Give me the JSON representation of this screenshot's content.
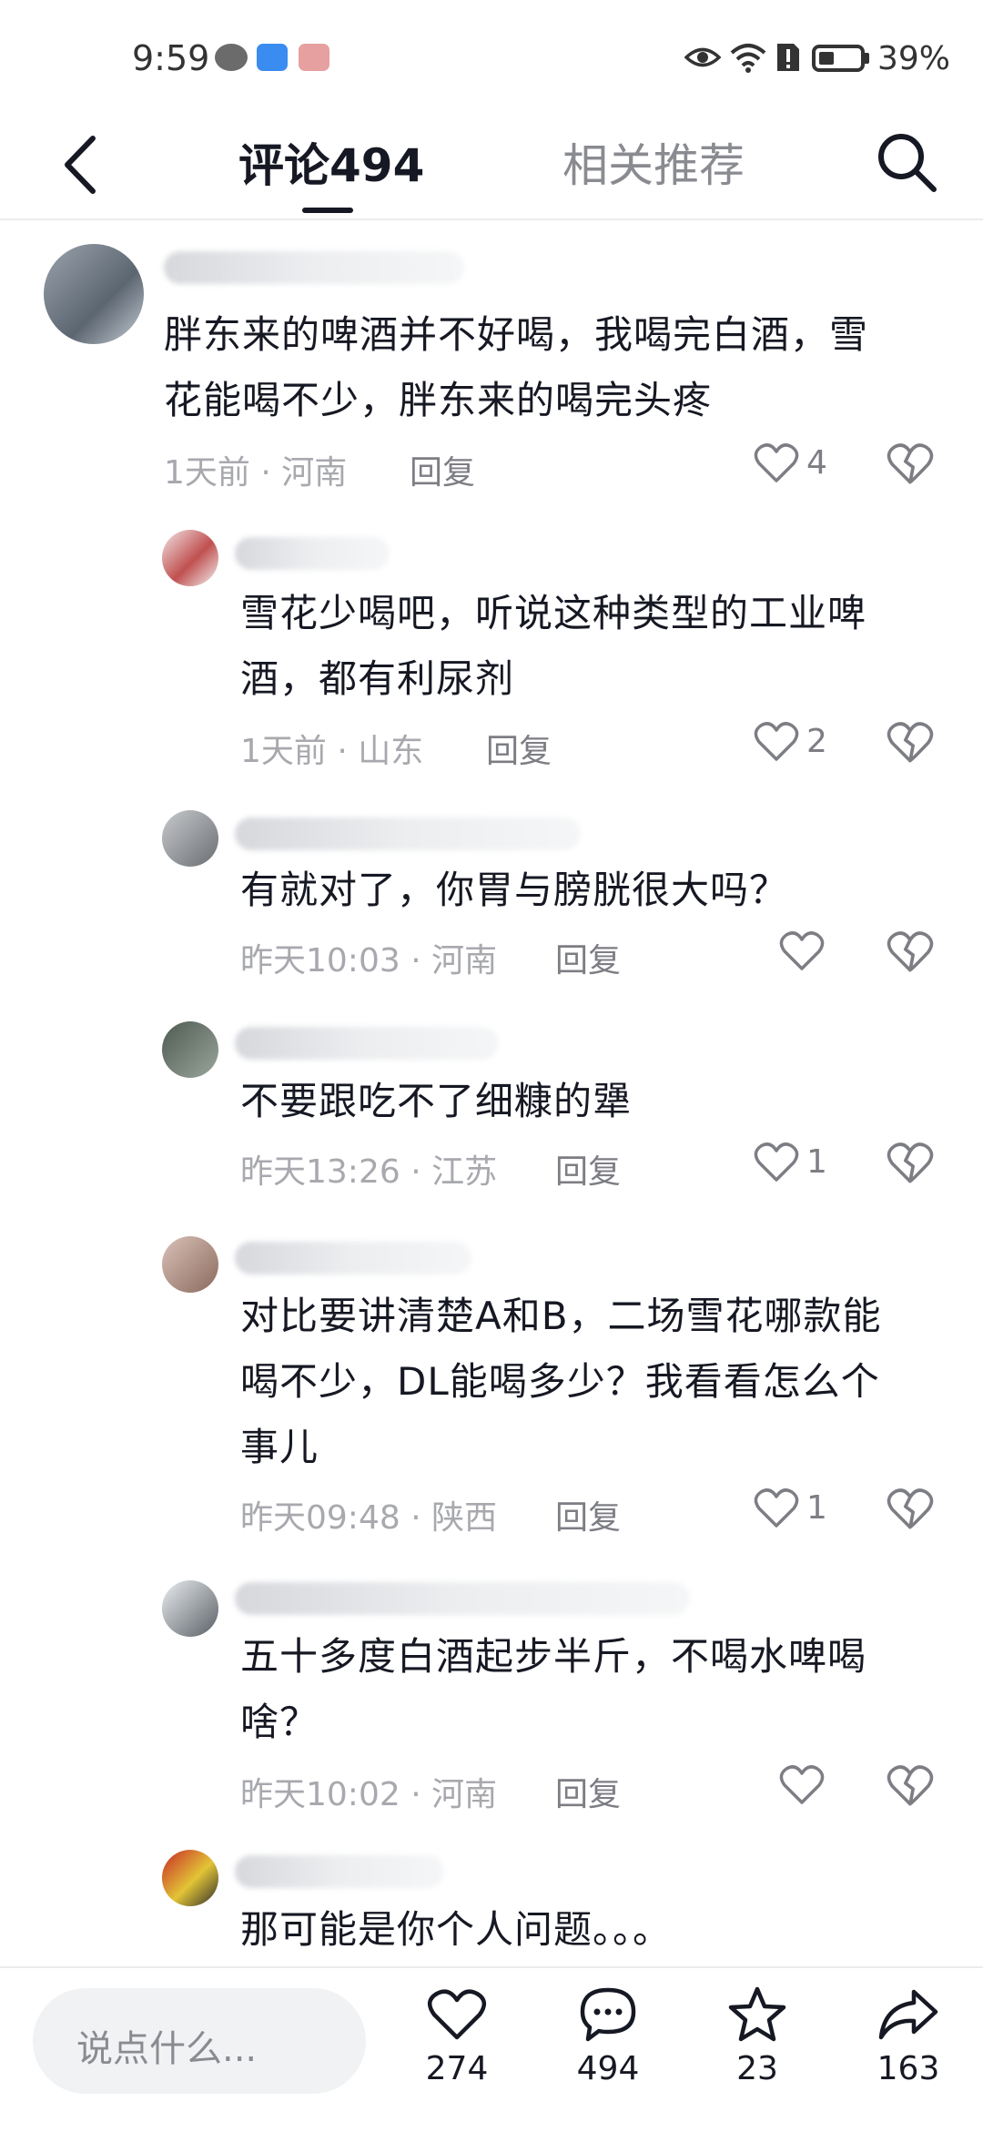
{
  "status_bar": {
    "time": "9:59",
    "battery": "39%",
    "battery_level": 0.39
  },
  "nav": {
    "tab_comments": "评论494",
    "tab_related": "相关推荐"
  },
  "comments": [
    {
      "text_lines": [
        "胖东来的啤酒并不好喝，我喝完白酒，雪",
        "花能喝不少，胖东来的喝完头疼"
      ],
      "meta": "1天前 · 河南",
      "reply": "回复",
      "likes": "4"
    },
    {
      "text_lines": [
        "雪花少喝吧，听说这种类型的工业啤",
        "酒，都有利尿剂"
      ],
      "meta": "1天前 · 山东",
      "reply": "回复",
      "likes": "2"
    },
    {
      "text_lines": [
        "有就对了，你胃与膀胱很大吗？"
      ],
      "meta": "昨天10:03 · 河南",
      "reply": "回复",
      "likes": ""
    },
    {
      "text_lines": [
        "不要跟吃不了细糠的犟"
      ],
      "meta": "昨天13:26 · 江苏",
      "reply": "回复",
      "likes": "1"
    },
    {
      "text_lines": [
        "对比要讲清楚A和B，二场雪花哪款能",
        "喝不少，DL能喝多少？我看看怎么个",
        "事儿"
      ],
      "meta": "昨天09:48 · 陕西",
      "reply": "回复",
      "likes": "1"
    },
    {
      "text_lines": [
        "五十多度白酒起步半斤，不喝水啤喝",
        "啥？"
      ],
      "meta": "昨天10:02 · 河南",
      "reply": "回复",
      "likes": ""
    },
    {
      "text_lines": [
        "那可能是你个人问题。。。"
      ]
    }
  ],
  "bottom_bar": {
    "input_placeholder": "说点什么...",
    "likes": "274",
    "comments": "494",
    "favorites": "23",
    "shares": "163"
  },
  "colors": {
    "primary_text": "#161823",
    "secondary_text": "#a8a9ae",
    "divider": "#ececec"
  }
}
